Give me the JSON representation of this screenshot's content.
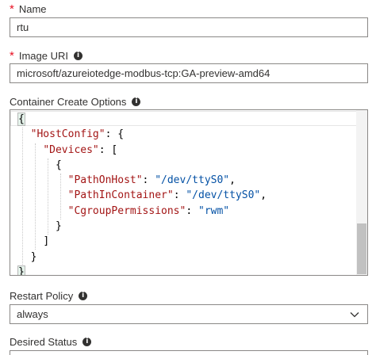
{
  "name_field": {
    "label": "Name",
    "value": "rtu"
  },
  "image_uri_field": {
    "label": "Image URI",
    "value": "microsoft/azureiotedge-modbus-tcp:GA-preview-amd64"
  },
  "container_options": {
    "label": "Container Create Options",
    "lines": {
      "l1": "{",
      "l2_key": "\"HostConfig\"",
      "l2_rest": ": {",
      "l3_key": "\"Devices\"",
      "l3_rest": ": [",
      "l4": "{",
      "l5_key": "\"PathOnHost\"",
      "l5_sep": ": ",
      "l5_val": "\"/dev/ttyS0\"",
      "l5_end": ",",
      "l6_key": "\"PathInContainer\"",
      "l6_sep": ": ",
      "l6_val": "\"/dev/ttyS0\"",
      "l6_end": ",",
      "l7_key": "\"CgroupPermissions\"",
      "l7_sep": ": ",
      "l7_val": "\"rwm\"",
      "l8": "}",
      "l9": "]",
      "l10": "}",
      "l11": "}"
    }
  },
  "restart_policy": {
    "label": "Restart Policy",
    "value": "always"
  },
  "desired_status": {
    "label": "Desired Status"
  },
  "icons": {
    "required": "asterisk",
    "info": "info-icon",
    "dropdown": "chevron-down-icon"
  }
}
